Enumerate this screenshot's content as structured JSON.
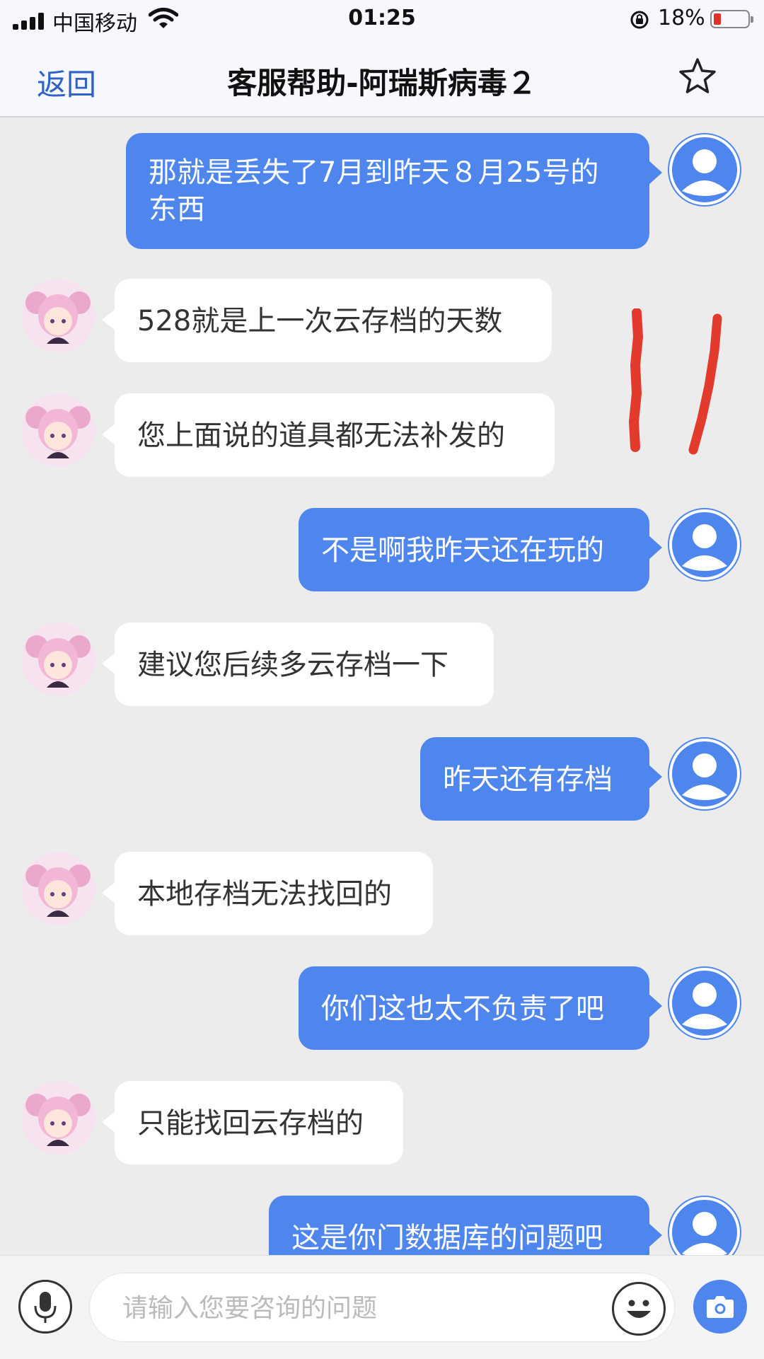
{
  "status_bar": {
    "carrier": "中国移动",
    "time": "01:25",
    "battery_percent": "18%",
    "battery_level": 0.18,
    "signal_bars": 4
  },
  "nav": {
    "back_label": "返回",
    "title": "客服帮助-阿瑞斯病毒２"
  },
  "messages": [
    {
      "from": "user",
      "text": "那就是丢失了7月到昨天８月25号的东西"
    },
    {
      "from": "agent",
      "text": "528就是上一次云存档的天数"
    },
    {
      "from": "agent",
      "text": "您上面说的道具都无法补发的"
    },
    {
      "from": "user",
      "text": "不是啊我昨天还在玩的"
    },
    {
      "from": "agent",
      "text": "建议您后续多云存档一下"
    },
    {
      "from": "user",
      "text": "昨天还有存档"
    },
    {
      "from": "agent",
      "text": "本地存档无法找回的"
    },
    {
      "from": "user",
      "text": "你们这也太不负责了吧"
    },
    {
      "from": "agent",
      "text": "只能找回云存档的"
    },
    {
      "from": "user",
      "text": "这是你门数据库的问题吧"
    }
  ],
  "input": {
    "placeholder": "请输入您要咨询的问题",
    "value": ""
  },
  "colors": {
    "accent": "#4e86ee",
    "link": "#2f62c8",
    "chat_background": "#ececec",
    "annotation_red": "#e23a2c"
  }
}
